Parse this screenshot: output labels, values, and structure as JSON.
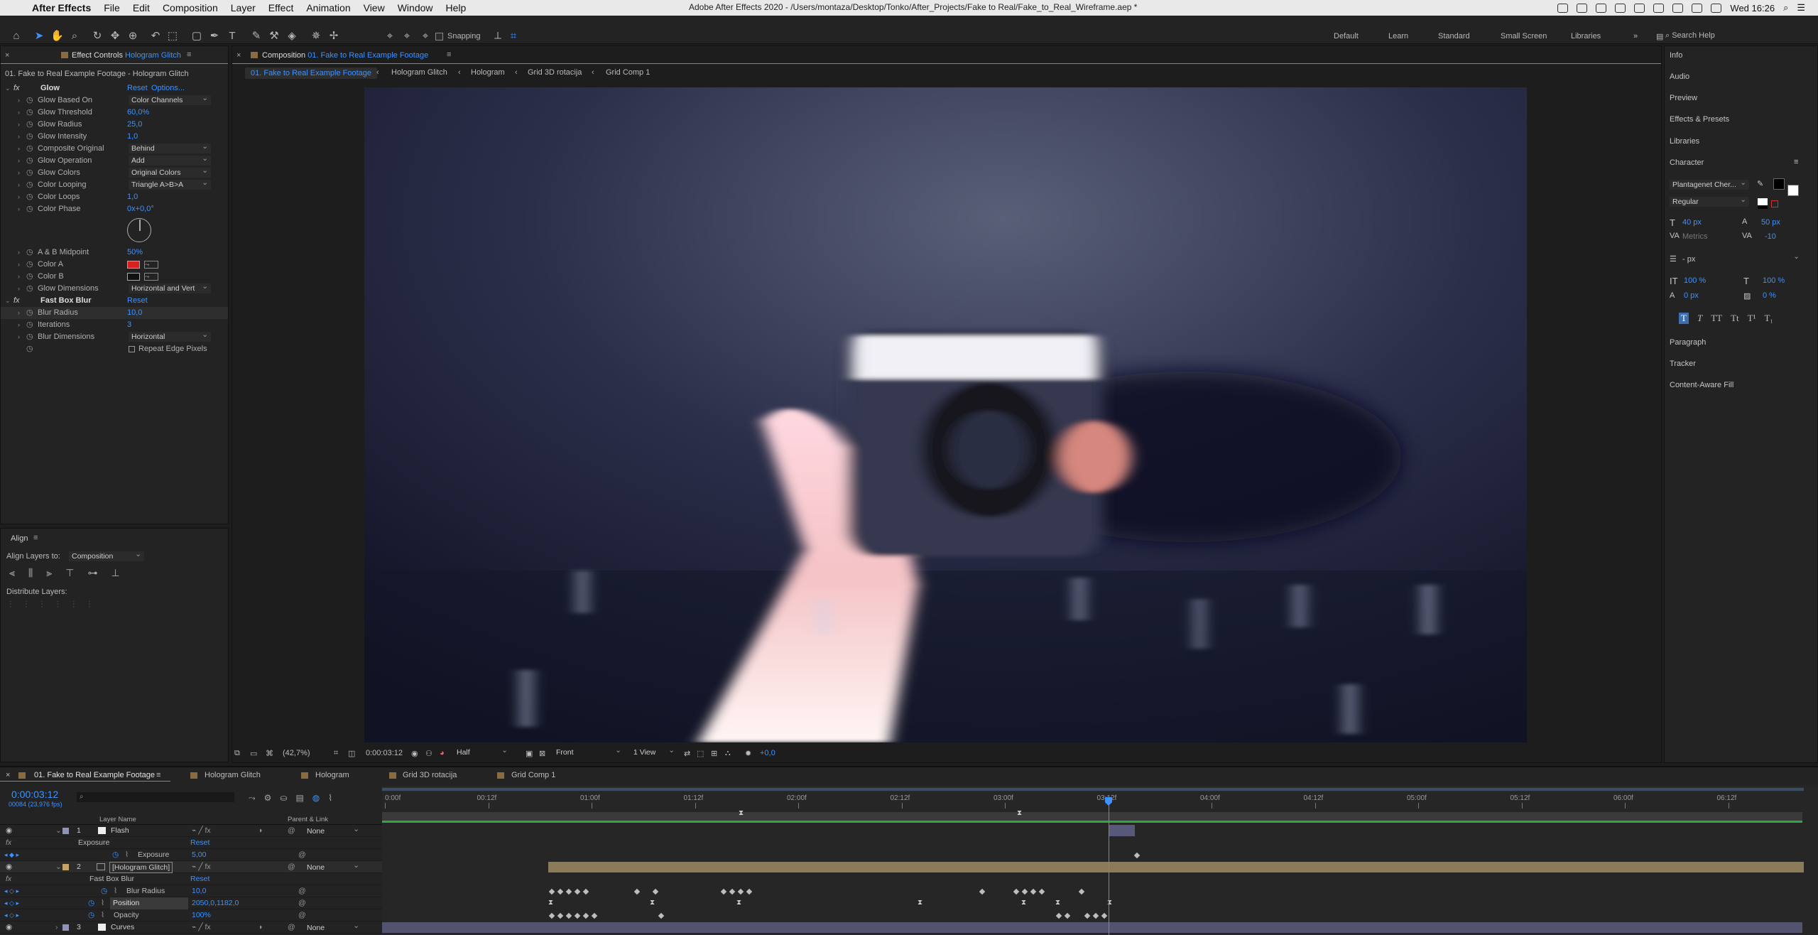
{
  "menubar": {
    "app": "After Effects",
    "items": [
      "File",
      "Edit",
      "Composition",
      "Layer",
      "Effect",
      "Animation",
      "View",
      "Window",
      "Help"
    ],
    "window_title": "Adobe After Effects 2020 - /Users/montaza/Desktop/Tonko/After_Projects/Fake to Real/Fake_to_Real_Wireframe.aep *",
    "clock": "Wed 16:26"
  },
  "toolbar": {
    "snapping": "Snapping",
    "workspaces": [
      "Default",
      "Learn",
      "Standard",
      "Small Screen",
      "Libraries"
    ],
    "search": "Search Help"
  },
  "effect_controls": {
    "tab": "Effect Controls",
    "tab_layer": "Hologram Glitch",
    "subtitle": "01. Fake to Real Example Footage - Hologram Glitch",
    "glow": {
      "name": "Glow",
      "reset": "Reset",
      "options": "Options...",
      "props": [
        {
          "label": "Glow Based On",
          "value": "Color Channels",
          "type": "dd"
        },
        {
          "label": "Glow Threshold",
          "value": "60,0%",
          "type": "val"
        },
        {
          "label": "Glow Radius",
          "value": "25,0",
          "type": "val"
        },
        {
          "label": "Glow Intensity",
          "value": "1,0",
          "type": "val"
        },
        {
          "label": "Composite Original",
          "value": "Behind",
          "type": "dd"
        },
        {
          "label": "Glow Operation",
          "value": "Add",
          "type": "dd"
        },
        {
          "label": "Glow Colors",
          "value": "Original Colors",
          "type": "dd"
        },
        {
          "label": "Color Looping",
          "value": "Triangle A>B>A",
          "type": "dd"
        },
        {
          "label": "Color Loops",
          "value": "1,0",
          "type": "val"
        },
        {
          "label": "Color Phase",
          "value": "0x+0,0°",
          "type": "val"
        }
      ],
      "props2": [
        {
          "label": "A & B Midpoint",
          "value": "50%",
          "type": "val"
        },
        {
          "label": "Color A",
          "value": "",
          "type": "color",
          "color": "#d92020"
        },
        {
          "label": "Color B",
          "value": "",
          "type": "color",
          "color": "#111111"
        },
        {
          "label": "Glow Dimensions",
          "value": "Horizontal and Vert",
          "type": "dd"
        }
      ]
    },
    "blur": {
      "name": "Fast Box Blur",
      "reset": "Reset",
      "props": [
        {
          "label": "Blur Radius",
          "value": "10,0",
          "type": "val"
        },
        {
          "label": "Iterations",
          "value": "3",
          "type": "val"
        },
        {
          "label": "Blur Dimensions",
          "value": "Horizontal",
          "type": "dd"
        }
      ],
      "repeat_edge": "Repeat Edge Pixels"
    }
  },
  "align": {
    "tab": "Align",
    "align_to_label": "Align Layers to:",
    "align_to_value": "Composition",
    "distribute": "Distribute Layers:"
  },
  "composition": {
    "tab": "Composition",
    "tab_name": "01. Fake to Real Example Footage",
    "breadcrumbs": [
      "01. Fake to Real Example Footage",
      "Hologram Glitch",
      "Hologram",
      "Grid 3D rotacija",
      "Grid Comp 1"
    ]
  },
  "viewer_controls": {
    "zoom": "(42,7%)",
    "time": "0:00:03:12",
    "resolution": "Half",
    "view": "Front",
    "views": "1 View",
    "exposure": "+0,0"
  },
  "right_panel": {
    "items_top": [
      "Info",
      "Audio",
      "Preview",
      "Effects & Presets",
      "Libraries"
    ],
    "character": {
      "title": "Character",
      "font": "Plantagenet Cher...",
      "style": "Regular",
      "size": "40 px",
      "leading": "50 px",
      "kerning": "Metrics",
      "tracking": "-10",
      "stroke": "- px",
      "vscale": "100 %",
      "hscale": "100 %",
      "baseline": "0 px",
      "tsume": "0 %",
      "styles": [
        "T",
        "T",
        "TT",
        "Tt",
        "T¹",
        "T₁"
      ]
    },
    "items_bottom": [
      "Paragraph",
      "Tracker",
      "Content-Aware Fill"
    ]
  },
  "timeline": {
    "tabs": [
      "01. Fake to Real Example Footage",
      "Hologram Glitch",
      "Hologram",
      "Grid 3D rotacija",
      "Grid Comp 1"
    ],
    "current_time": "0:00:03:12",
    "frame_info": "00084 (23,976 fps)",
    "col_layer_name": "Layer Name",
    "col_parent": "Parent & Link",
    "ruler": [
      "0:00f",
      "00:12f",
      "01:00f",
      "01:12f",
      "02:00f",
      "02:12f",
      "03:00f",
      "03:12f",
      "04:00f",
      "04:12f",
      "05:00f",
      "05:12f",
      "06:00f",
      "06:12f"
    ],
    "layers": [
      {
        "num": "1",
        "name": "Flash",
        "parent": "None"
      },
      {
        "num": "2",
        "name": "[Hologram Glitch]",
        "parent": "None"
      },
      {
        "num": "3",
        "name": "Curves",
        "parent": "None"
      }
    ],
    "exposure_group": "Exposure",
    "exposure_reset": "Reset",
    "exposure_label": "Exposure",
    "exposure_value": "5,00",
    "blur_group": "Fast Box Blur",
    "blur_reset": "Reset",
    "blur_radius_label": "Blur Radius",
    "blur_radius_value": "10,0",
    "position_label": "Position",
    "position_value": "2050,0,1182,0",
    "opacity_label": "Opacity",
    "opacity_value": "100%"
  }
}
